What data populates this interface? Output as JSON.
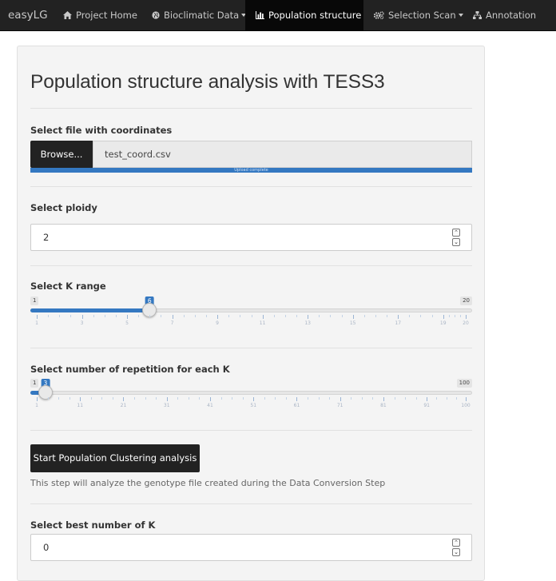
{
  "navbar": {
    "brand": "easyLG",
    "items": [
      {
        "label": "Project Home",
        "icon": "home-icon",
        "active": false,
        "dropdown": false
      },
      {
        "label": "Bioclimatic Data",
        "icon": "globe-icon",
        "active": false,
        "dropdown": true
      },
      {
        "label": "Population structure",
        "icon": "bar-chart-icon",
        "active": true,
        "dropdown": false
      },
      {
        "label": "Selection Scan",
        "icon": "cogs-icon",
        "active": false,
        "dropdown": true
      },
      {
        "label": "Annotation",
        "icon": "sitemap-icon",
        "active": false,
        "dropdown": false
      }
    ]
  },
  "panel": {
    "title": "Population structure analysis with TESS3",
    "file_input": {
      "label": "Select file with coordinates",
      "browse_label": "Browse...",
      "filename": "test_coord.csv",
      "progress_text": "Upload complete",
      "progress": 1.0
    },
    "ploidy": {
      "label": "Select ploidy",
      "value": "2"
    },
    "k_range": {
      "label": "Select K range",
      "min": "1",
      "max": "20",
      "value": "6",
      "tick_labels": [
        "1",
        "3",
        "5",
        "7",
        "9",
        "11",
        "13",
        "15",
        "17",
        "19",
        "20"
      ]
    },
    "repetitions": {
      "label": "Select number of repetition for each K",
      "min": "1",
      "max": "100",
      "value": "3",
      "tick_labels": [
        "1",
        "11",
        "21",
        "31",
        "41",
        "51",
        "61",
        "71",
        "81",
        "91",
        "100"
      ]
    },
    "start_button": "Start Population Clustering analysis",
    "help_text": "This step will analyze the genotype file created during the Data Conversion Step",
    "best_k": {
      "label": "Select best number of K",
      "value": "0"
    }
  },
  "colors": {
    "navbar_bg": "#222222",
    "active_tab_bg": "#080808",
    "accent": "#3478c1",
    "panel_bg": "#f4f4f4",
    "button_bg": "#222222"
  }
}
